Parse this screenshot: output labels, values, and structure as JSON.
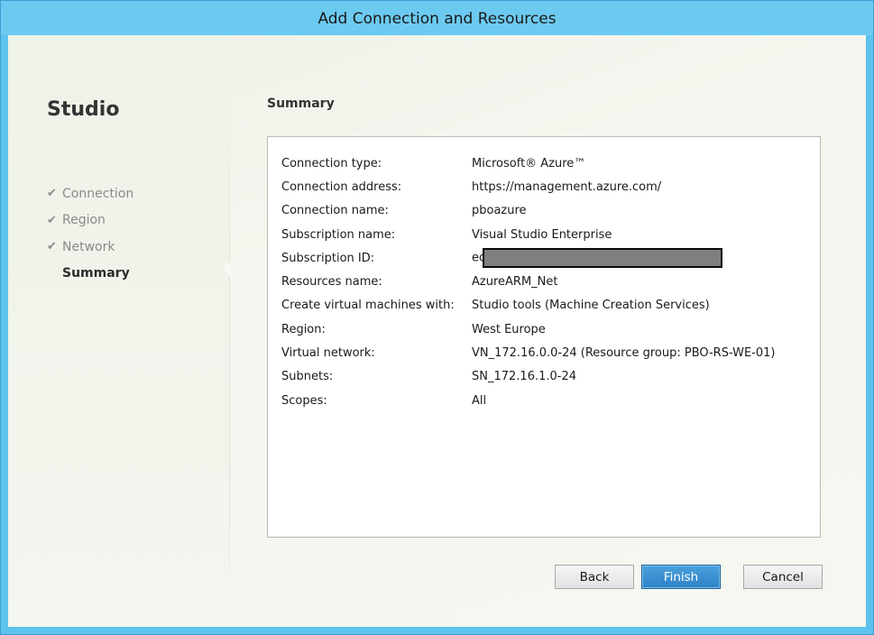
{
  "window": {
    "title": "Add Connection and Resources"
  },
  "sidebar": {
    "brand": "Studio",
    "steps": [
      {
        "label": "Connection",
        "done": true
      },
      {
        "label": "Region",
        "done": true
      },
      {
        "label": "Network",
        "done": true
      },
      {
        "label": "Summary",
        "done": false,
        "current": true
      }
    ],
    "check_glyph": "✔"
  },
  "main": {
    "title": "Summary",
    "rows": [
      {
        "label": "Connection type:",
        "value": "Microsoft® Azure™"
      },
      {
        "label": "Connection address:",
        "value": "https://management.azure.com/"
      },
      {
        "label": "Connection name:",
        "value": "pboazure"
      },
      {
        "label": "Subscription name:",
        "value": "Visual Studio Enterprise"
      },
      {
        "label": "Subscription ID:",
        "value": "ed"
      },
      {
        "label": "Resources name:",
        "value": "AzureARM_Net"
      },
      {
        "label": "Create virtual machines with:",
        "value": "Studio tools (Machine Creation Services)"
      },
      {
        "label": "Region:",
        "value": "West Europe"
      },
      {
        "label": "Virtual network:",
        "value": "VN_172.16.0.0-24 (Resource group: PBO-RS-WE-01)"
      },
      {
        "label": "Subnets:",
        "value": "SN_172.16.1.0-24"
      },
      {
        "label": "Scopes:",
        "value": "All"
      }
    ]
  },
  "buttons": {
    "back": "Back",
    "finish": "Finish",
    "cancel": "Cancel"
  },
  "colors": {
    "titlebar": "#6ccaf0",
    "accent": "#2e82c6",
    "redaction": "#7f7f7f"
  }
}
